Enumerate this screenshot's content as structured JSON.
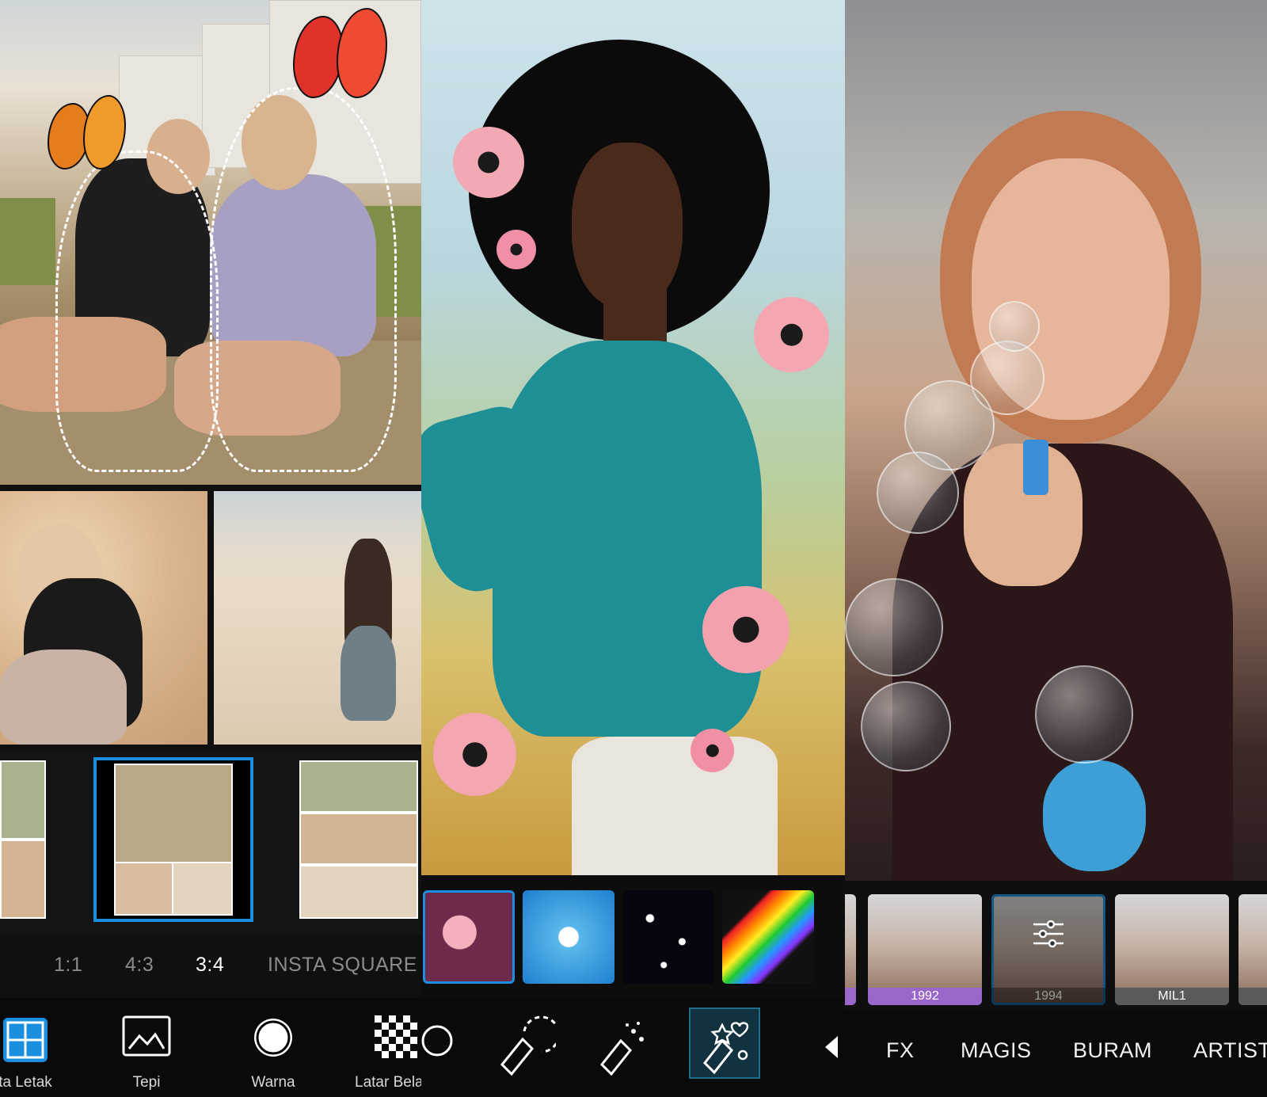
{
  "panel1": {
    "ratios": [
      {
        "label": "1:1",
        "active": false
      },
      {
        "label": "4:3",
        "active": false
      },
      {
        "label": "3:4",
        "active": true
      },
      {
        "label": "INSTA SQUARE",
        "active": false
      }
    ],
    "tools": [
      {
        "label": "ta Letak",
        "icon": "layout-icon"
      },
      {
        "label": "Tepi",
        "icon": "image-border-icon"
      },
      {
        "label": "Warna",
        "icon": "color-circle-icon"
      },
      {
        "label": "Latar Bela",
        "icon": "checkerboard-background-icon"
      }
    ],
    "accent": "#1a8fe0"
  },
  "panel2": {
    "stickers": [
      "pink-flowers-sticker",
      "white-blossoms-sticker",
      "sparkle-stars-sticker",
      "rainbow-sticker"
    ],
    "tools": [
      "brush-erase-icon",
      "brush-dashed-icon",
      "sparkle-brush-icon",
      "magic-sticker-brush-icon"
    ]
  },
  "panel3": {
    "filters": [
      {
        "name": "",
        "tint": "#9b66c9"
      },
      {
        "name": "1992",
        "tint": "#9b66c9",
        "selected": false
      },
      {
        "name": "1994",
        "tint": "#1a8fe0",
        "selected": true
      },
      {
        "name": "MIL1",
        "tint": "#666666",
        "selected": false
      }
    ],
    "categories": [
      "FX",
      "MAGIS",
      "BURAM",
      "ARTIST"
    ]
  }
}
